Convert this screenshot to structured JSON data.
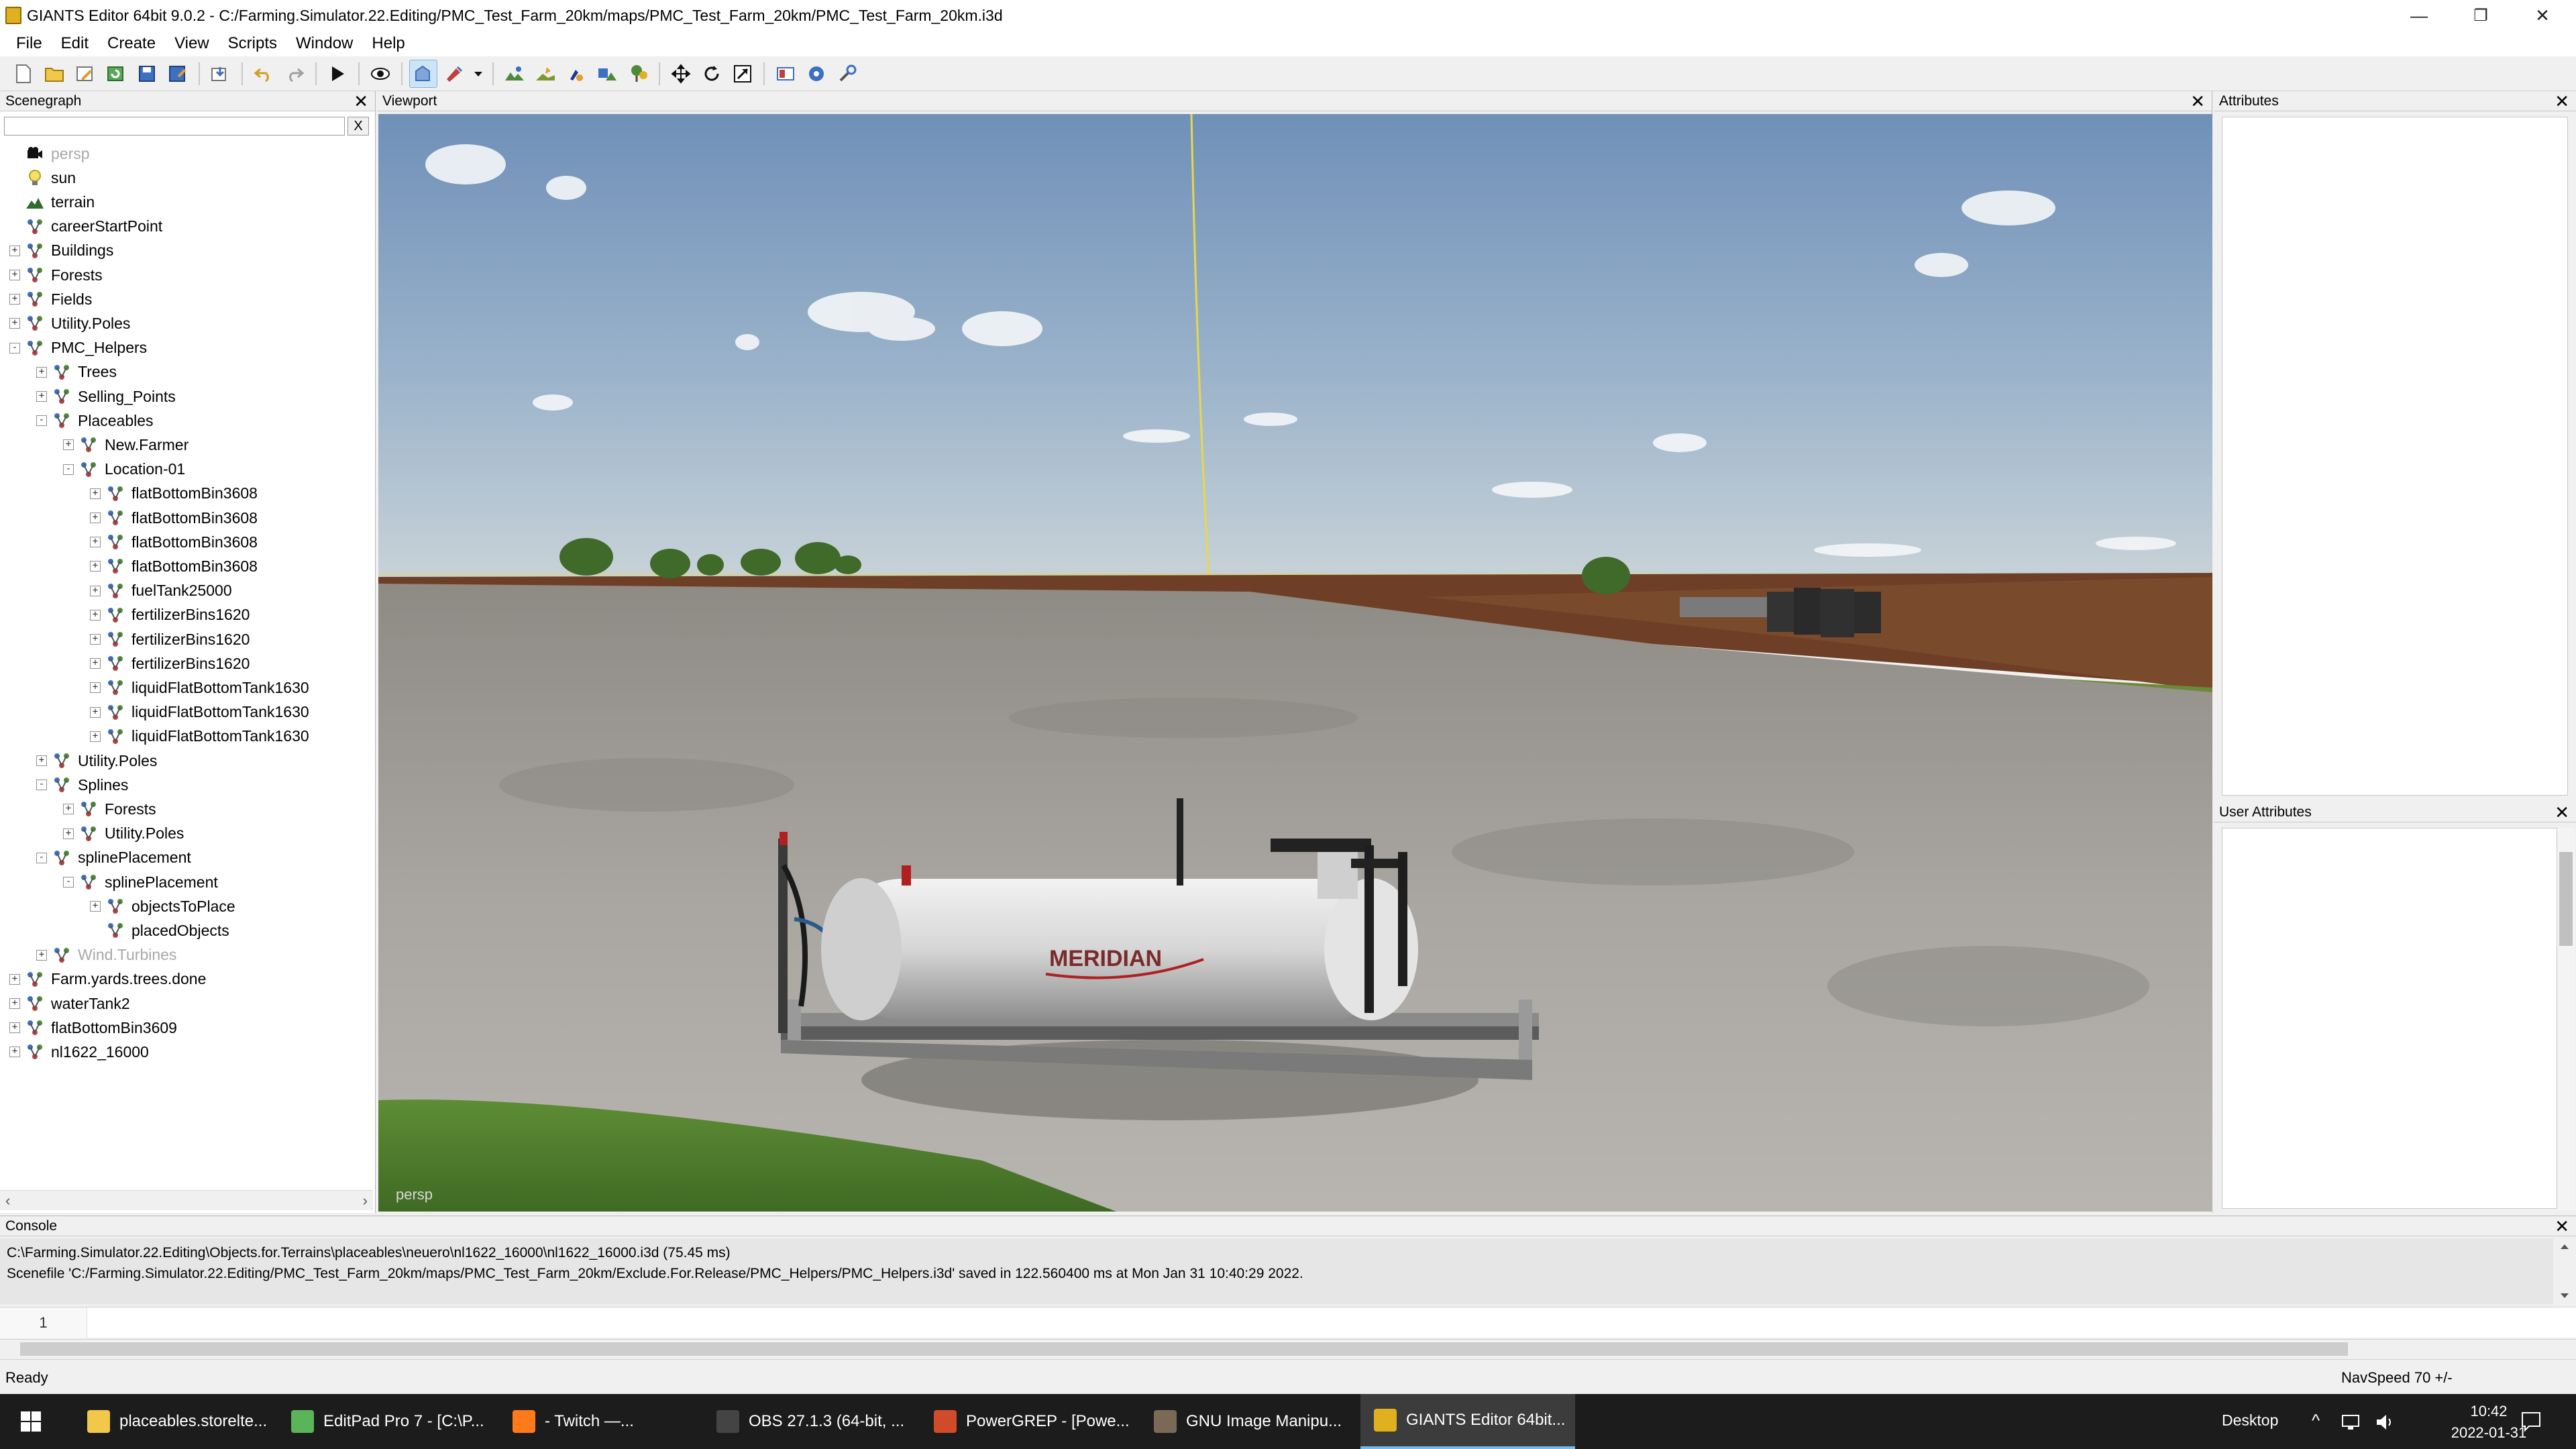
{
  "window": {
    "title": "GIANTS Editor 64bit 9.0.2 - C:/Farming.Simulator.22.Editing/PMC_Test_Farm_20km/maps/PMC_Test_Farm_20km/PMC_Test_Farm_20km.i3d",
    "minimize": "—",
    "restore": "❐",
    "close": "✕"
  },
  "menu": [
    "File",
    "Edit",
    "Create",
    "View",
    "Scripts",
    "Window",
    "Help"
  ],
  "toolbar": {
    "icons": [
      "new-file-icon",
      "open-folder-icon",
      "edit-icon",
      "reload-icon",
      "save-icon",
      "save-as-icon",
      "import-icon",
      "undo-icon",
      "redo-icon",
      "play-icon",
      "view-icon",
      "camera-icon",
      "paint-icon",
      "dropdown-icon",
      "terrain-sculpt-icon",
      "terrain-paint-icon",
      "foliage-paint-icon",
      "decal-icon",
      "spline-icon",
      "move-icon",
      "rotate-icon",
      "scale-icon",
      "layout-icon",
      "settings-icon",
      "tool-icon"
    ]
  },
  "scenegraph": {
    "title": "Scenegraph",
    "search_value": "",
    "clear_label": "X",
    "close": "✕",
    "nodes": [
      {
        "label": "persp",
        "depth": 0,
        "exp": "",
        "icon": "camera",
        "dim": true
      },
      {
        "label": "sun",
        "depth": 0,
        "exp": "",
        "icon": "light"
      },
      {
        "label": "terrain",
        "depth": 0,
        "exp": "",
        "icon": "terrain"
      },
      {
        "label": "careerStartPoint",
        "depth": 0,
        "exp": "",
        "icon": "transform"
      },
      {
        "label": "Buildings",
        "depth": 0,
        "exp": "+",
        "icon": "transform"
      },
      {
        "label": "Forests",
        "depth": 0,
        "exp": "+",
        "icon": "transform"
      },
      {
        "label": "Fields",
        "depth": 0,
        "exp": "+",
        "icon": "transform"
      },
      {
        "label": "Utility.Poles",
        "depth": 0,
        "exp": "+",
        "icon": "transform"
      },
      {
        "label": "PMC_Helpers",
        "depth": 0,
        "exp": "-",
        "icon": "transform"
      },
      {
        "label": "Trees",
        "depth": 1,
        "exp": "+",
        "icon": "transform"
      },
      {
        "label": "Selling_Points",
        "depth": 1,
        "exp": "+",
        "icon": "transform"
      },
      {
        "label": "Placeables",
        "depth": 1,
        "exp": "-",
        "icon": "transform"
      },
      {
        "label": "New.Farmer",
        "depth": 2,
        "exp": "+",
        "icon": "transform"
      },
      {
        "label": "Location-01",
        "depth": 2,
        "exp": "-",
        "icon": "transform"
      },
      {
        "label": "flatBottomBin3608",
        "depth": 3,
        "exp": "+",
        "icon": "transform"
      },
      {
        "label": "flatBottomBin3608",
        "depth": 3,
        "exp": "+",
        "icon": "transform"
      },
      {
        "label": "flatBottomBin3608",
        "depth": 3,
        "exp": "+",
        "icon": "transform"
      },
      {
        "label": "flatBottomBin3608",
        "depth": 3,
        "exp": "+",
        "icon": "transform"
      },
      {
        "label": "fuelTank25000",
        "depth": 3,
        "exp": "+",
        "icon": "transform"
      },
      {
        "label": "fertilizerBins1620",
        "depth": 3,
        "exp": "+",
        "icon": "transform"
      },
      {
        "label": "fertilizerBins1620",
        "depth": 3,
        "exp": "+",
        "icon": "transform"
      },
      {
        "label": "fertilizerBins1620",
        "depth": 3,
        "exp": "+",
        "icon": "transform"
      },
      {
        "label": "liquidFlatBottomTank1630",
        "depth": 3,
        "exp": "+",
        "icon": "transform"
      },
      {
        "label": "liquidFlatBottomTank1630",
        "depth": 3,
        "exp": "+",
        "icon": "transform"
      },
      {
        "label": "liquidFlatBottomTank1630",
        "depth": 3,
        "exp": "+",
        "icon": "transform"
      },
      {
        "label": "Utility.Poles",
        "depth": 1,
        "exp": "+",
        "icon": "transform"
      },
      {
        "label": "Splines",
        "depth": 1,
        "exp": "-",
        "icon": "transform"
      },
      {
        "label": "Forests",
        "depth": 2,
        "exp": "+",
        "icon": "transform"
      },
      {
        "label": "Utility.Poles",
        "depth": 2,
        "exp": "+",
        "icon": "transform"
      },
      {
        "label": "splinePlacement",
        "depth": 1,
        "exp": "-",
        "icon": "transform"
      },
      {
        "label": "splinePlacement",
        "depth": 2,
        "exp": "-",
        "icon": "transform"
      },
      {
        "label": "objectsToPlace",
        "depth": 3,
        "exp": "+",
        "icon": "transform"
      },
      {
        "label": "placedObjects",
        "depth": 3,
        "exp": "",
        "icon": "transform"
      },
      {
        "label": "Wind.Turbines",
        "depth": 1,
        "exp": "+",
        "icon": "transform",
        "dim": true
      },
      {
        "label": "Farm.yards.trees.done",
        "depth": 0,
        "exp": "+",
        "icon": "transform"
      },
      {
        "label": "waterTank2",
        "depth": 0,
        "exp": "+",
        "icon": "transform"
      },
      {
        "label": "flatBottomBin3609",
        "depth": 0,
        "exp": "+",
        "icon": "transform"
      },
      {
        "label": "nl1622_16000",
        "depth": 0,
        "exp": "+",
        "icon": "transform"
      }
    ]
  },
  "viewport": {
    "title": "Viewport",
    "close": "✕",
    "camera_label": "persp",
    "tank_brand": "MERIDIAN"
  },
  "attributes": {
    "title": "Attributes",
    "close": "✕"
  },
  "user_attributes": {
    "title": "User Attributes",
    "close": "✕"
  },
  "console": {
    "title": "Console",
    "close": "✕",
    "lines": [
      "C:\\Farming.Simulator.22.Editing\\Objects.for.Terrains\\placeables\\neuero\\nl1622_16000\\nl1622_16000.i3d (75.45 ms)",
      "Scenefile 'C:/Farming.Simulator.22.Editing/PMC_Test_Farm_20km/maps/PMC_Test_Farm_20km/Exclude.For.Release/PMC_Helpers/PMC_Helpers.i3d' saved in 122.560400 ms at Mon Jan 31 10:40:29 2022."
    ],
    "line_number": "1"
  },
  "status": {
    "ready": "Ready",
    "navspeed": "NavSpeed 70 +/-"
  },
  "taskbar": {
    "items": [
      {
        "label": "placeables.storelte...",
        "icon": "folder-icon",
        "color": "#f2c84b"
      },
      {
        "label": "EditPad Pro 7 - [C:\\P...",
        "icon": "editpad-icon",
        "color": "#5ab45a"
      },
      {
        "label": "- Twitch —...",
        "icon": "firefox-icon",
        "color": "#ff7a1a"
      },
      {
        "label": "OBS 27.1.3 (64-bit, ...",
        "icon": "obs-icon",
        "color": "#444444"
      },
      {
        "label": "PowerGREP - [Powe...",
        "icon": "powergrep-icon",
        "color": "#d14b2a"
      },
      {
        "label": "GNU Image Manipu...",
        "icon": "gimp-icon",
        "color": "#7a6a55"
      },
      {
        "label": "GIANTS Editor 64bit...",
        "icon": "giants-icon",
        "color": "#e0b020"
      }
    ],
    "desktop_label": "Desktop",
    "time": "10:42",
    "date": "2022-01-31"
  },
  "colors": {
    "accent": "#76b9ed",
    "sky_top": "#6f90b8",
    "sky_bottom": "#c9d3d8",
    "gravel": "#a6a39e",
    "field": "#6e3f26",
    "grass": "#4d7a2c"
  }
}
